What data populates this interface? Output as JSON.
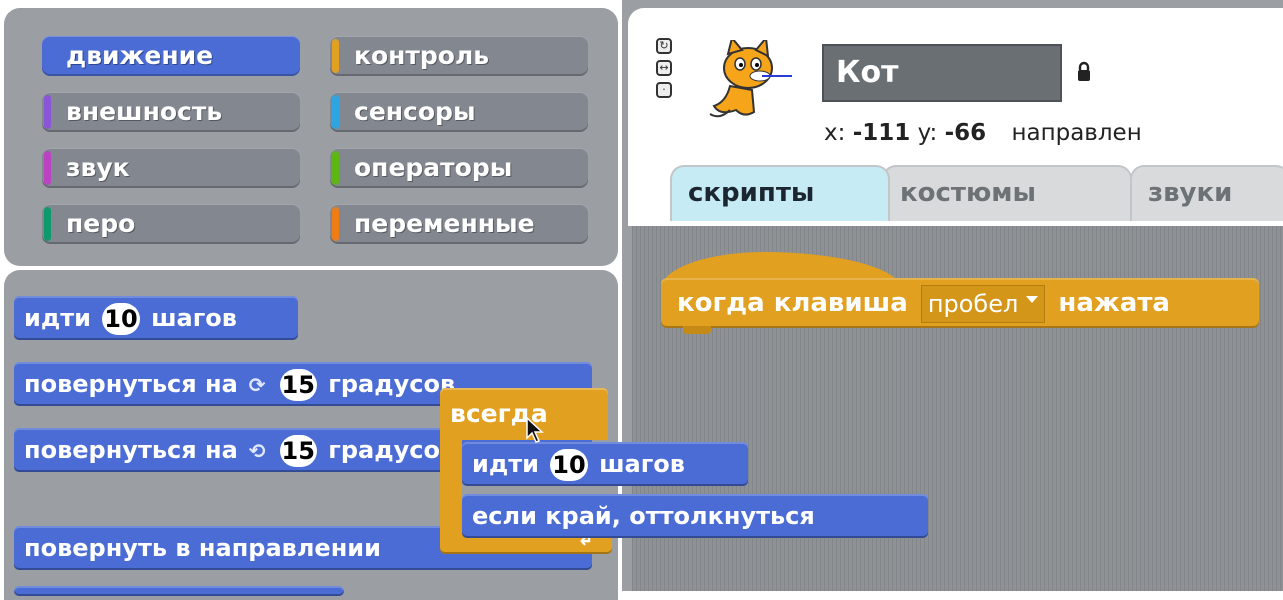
{
  "categories": [
    {
      "label": "движение",
      "color": "#4a6cd4",
      "active": true
    },
    {
      "label": "контроль",
      "color": "#e1a020",
      "active": false
    },
    {
      "label": "внешность",
      "color": "#8a55d7",
      "active": false
    },
    {
      "label": "сенсоры",
      "color": "#2ca5e2",
      "active": false
    },
    {
      "label": "звук",
      "color": "#bb42c3",
      "active": false
    },
    {
      "label": "операторы",
      "color": "#5cb712",
      "active": false
    },
    {
      "label": "перо",
      "color": "#0e9a6c",
      "active": false
    },
    {
      "label": "переменные",
      "color": "#ee7d16",
      "active": false
    }
  ],
  "palette": {
    "move_prefix": "идти",
    "move_value": "10",
    "move_suffix": "шагов",
    "turn_right_prefix": "повернуться на",
    "turn_right_icon": "rotate-clockwise-icon",
    "turn_right_value": "15",
    "turn_right_suffix": "градусов",
    "turn_left_prefix": "повернуться на",
    "turn_left_icon": "rotate-counterclockwise-icon",
    "turn_left_value": "15",
    "turn_left_suffix": "градусов",
    "point_direction": "повернуть в направлении"
  },
  "sprite": {
    "name": "Кот",
    "icon": "cat-sprite-icon",
    "x_label": "x:",
    "x_value": "-111",
    "y_label": "y:",
    "y_value": "-66",
    "direction_label": "направлен",
    "rotation_style_icons": [
      "rotate-all-icon",
      "left-right-icon",
      "no-rotate-icon"
    ]
  },
  "tabs": [
    {
      "label": "скрипты",
      "active": true
    },
    {
      "label": "костюмы",
      "active": false
    },
    {
      "label": "звуки",
      "active": false
    }
  ],
  "script": {
    "hat_prefix": "когда клавиша",
    "hat_key": "пробел",
    "hat_suffix": "нажата"
  },
  "dragged": {
    "forever_label": "всегда",
    "inner_move_prefix": "идти",
    "inner_move_value": "10",
    "inner_move_suffix": "шагов",
    "inner_bounce": "если край, оттолкнуться"
  }
}
